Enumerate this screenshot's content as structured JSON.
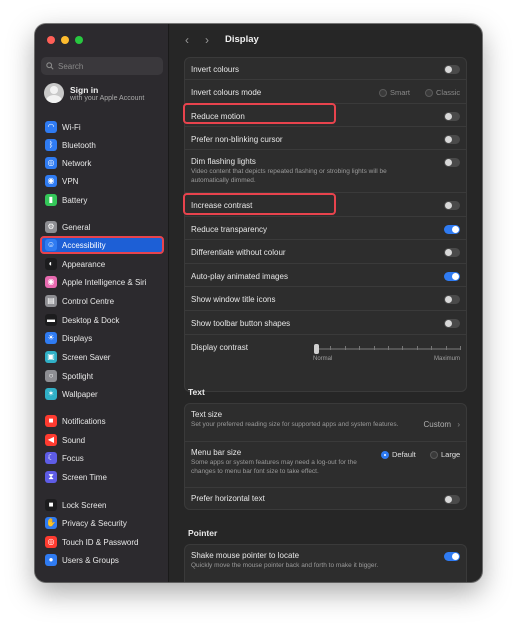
{
  "window": {
    "title": "Display"
  },
  "search": {
    "placeholder": "Search"
  },
  "account": {
    "title": "Sign in",
    "subtitle": "with your Apple Account"
  },
  "sidebar": {
    "items": [
      {
        "label": "Wi-Fi",
        "icon": "wifi-icon",
        "color": "#2f7bf2"
      },
      {
        "label": "Bluetooth",
        "icon": "bluetooth-icon",
        "color": "#2f7bf2"
      },
      {
        "label": "Network",
        "icon": "globe-icon",
        "color": "#2f7bf2"
      },
      {
        "label": "VPN",
        "icon": "vpn-icon",
        "color": "#2f7bf2"
      },
      {
        "label": "Battery",
        "icon": "battery-icon",
        "color": "#34c759"
      },
      {
        "label": "General",
        "icon": "gear-icon",
        "color": "#8e8e93"
      },
      {
        "label": "Accessibility",
        "icon": "accessibility-icon",
        "color": "#2f7bf2"
      },
      {
        "label": "Appearance",
        "icon": "appearance-icon",
        "color": "#1c1c1e"
      },
      {
        "label": "Apple Intelligence & Siri",
        "icon": "siri-icon",
        "color": "#e86ab0"
      },
      {
        "label": "Control Centre",
        "icon": "control-centre-icon",
        "color": "#8e8e93"
      },
      {
        "label": "Desktop & Dock",
        "icon": "dock-icon",
        "color": "#1c1c1e"
      },
      {
        "label": "Displays",
        "icon": "display-icon",
        "color": "#2f7bf2"
      },
      {
        "label": "Screen Saver",
        "icon": "screen-saver-icon",
        "color": "#30b0c7"
      },
      {
        "label": "Spotlight",
        "icon": "spotlight-icon",
        "color": "#8e8e93"
      },
      {
        "label": "Wallpaper",
        "icon": "wallpaper-icon",
        "color": "#30b0c7"
      },
      {
        "label": "Notifications",
        "icon": "bell-icon",
        "color": "#ff3b30"
      },
      {
        "label": "Sound",
        "icon": "speaker-icon",
        "color": "#ff3b30"
      },
      {
        "label": "Focus",
        "icon": "moon-icon",
        "color": "#5e5ce6"
      },
      {
        "label": "Screen Time",
        "icon": "hourglass-icon",
        "color": "#5e5ce6"
      },
      {
        "label": "Lock Screen",
        "icon": "lock-icon",
        "color": "#1c1c1e"
      },
      {
        "label": "Privacy & Security",
        "icon": "hand-icon",
        "color": "#2f7bf2"
      },
      {
        "label": "Touch ID & Password",
        "icon": "fingerprint-icon",
        "color": "#ff3b30"
      },
      {
        "label": "Users & Groups",
        "icon": "users-icon",
        "color": "#2f7bf2"
      }
    ]
  },
  "display_group": {
    "invert_colours": {
      "label": "Invert colours",
      "on": false
    },
    "invert_mode": {
      "label": "Invert colours mode",
      "smart": "Smart",
      "classic": "Classic"
    },
    "reduce_motion": {
      "label": "Reduce motion",
      "on": false
    },
    "non_blinking": {
      "label": "Prefer non-blinking cursor",
      "on": false
    },
    "dim_flashing": {
      "label": "Dim flashing lights",
      "desc": "Video content that depicts repeated flashing or strobing lights will be automatically dimmed.",
      "on": false
    },
    "increase_contrast": {
      "label": "Increase contrast",
      "on": false
    },
    "reduce_transparency": {
      "label": "Reduce transparency",
      "on": true
    },
    "differentiate": {
      "label": "Differentiate without colour",
      "on": false
    },
    "autoplay": {
      "label": "Auto-play animated images",
      "on": true
    },
    "window_icons": {
      "label": "Show window title icons",
      "on": false
    },
    "toolbar_shapes": {
      "label": "Show toolbar button shapes",
      "on": false
    },
    "contrast": {
      "label": "Display contrast",
      "min_label": "Normal",
      "max_label": "Maximum",
      "value": 0
    }
  },
  "text_section": {
    "heading": "Text",
    "text_size": {
      "label": "Text size",
      "desc": "Set your preferred reading size for supported apps and system features.",
      "value": "Custom"
    },
    "menu_bar": {
      "label": "Menu bar size",
      "desc": "Some apps or system features may need a log-out for the changes to menu bar font size to take effect.",
      "default": "Default",
      "large": "Large"
    },
    "horizontal_text": {
      "label": "Prefer horizontal text",
      "on": false
    }
  },
  "pointer_section": {
    "heading": "Pointer",
    "shake": {
      "label": "Shake mouse pointer to locate",
      "desc": "Quickly move the mouse pointer back and forth to make it bigger.",
      "on": true
    }
  },
  "colors": {
    "accent": "#2f7bf2",
    "highlight": "#e8434d",
    "close": "#ff5f57",
    "minimize": "#febc2e",
    "zoom": "#28c840"
  }
}
